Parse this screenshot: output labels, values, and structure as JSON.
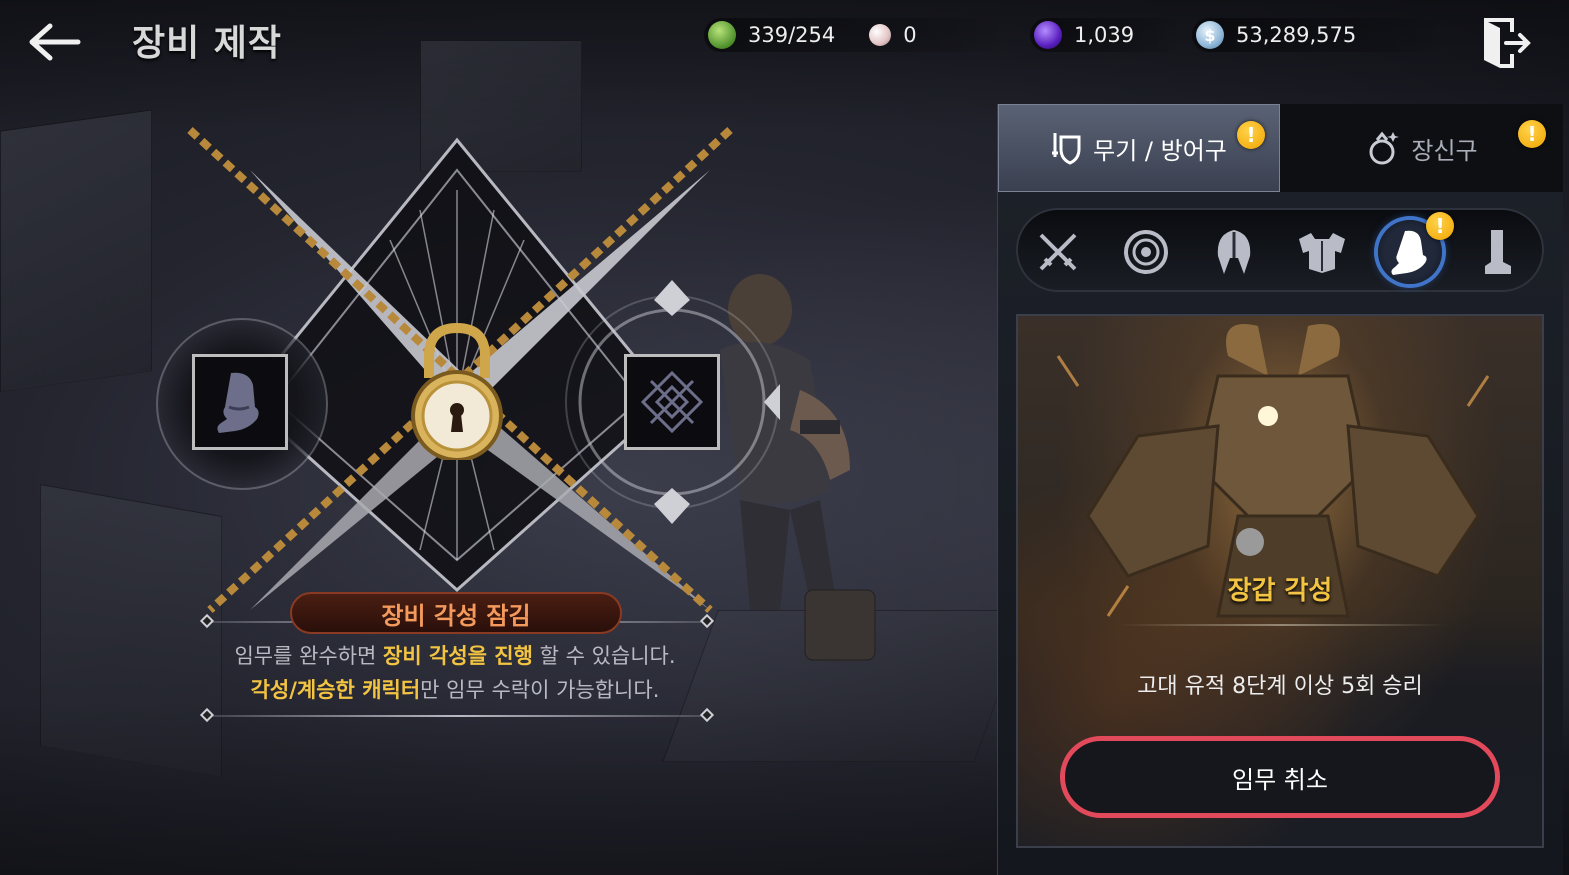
{
  "header": {
    "title": "장비 제작",
    "currencies": [
      {
        "icon": "green-gem-icon",
        "value": "339/254",
        "color": "#5fae3c"
      },
      {
        "icon": "pearl-icon",
        "value": "0",
        "color": "#e8c9c9"
      },
      {
        "icon": "purple-orb-icon",
        "value": "1,039",
        "color": "#6a2fc9"
      },
      {
        "icon": "silver-coin-icon",
        "value": "53,289,575",
        "color": "#8fb7d8"
      }
    ]
  },
  "awakening": {
    "locked_title": "장비 각성 잠김",
    "desc_line1_a": "임무를 완수하면 ",
    "desc_line1_hl": "장비 각성을 진행",
    "desc_line1_b": " 할 수 있습니다.",
    "desc_line2_hl": "각성/계승한 캐릭터",
    "desc_line2_b": "만 임무 수락이 가능합니다.",
    "left_slot_icon": "gauntlet-icon",
    "right_slot_icon": "awaken-symbol-icon"
  },
  "panel": {
    "tabs": [
      {
        "label": "무기 / 방어구",
        "icon": "weapon-armor-icon",
        "active": true,
        "alert": "!"
      },
      {
        "label": "장신구",
        "icon": "accessory-icon",
        "active": false,
        "alert": "!"
      }
    ],
    "categories": [
      {
        "name": "weapon",
        "icon": "crossed-swords-icon"
      },
      {
        "name": "shield",
        "icon": "shield-icon"
      },
      {
        "name": "helmet",
        "icon": "helmet-icon"
      },
      {
        "name": "armor",
        "icon": "chest-armor-icon"
      },
      {
        "name": "gloves",
        "icon": "gauntlet-icon",
        "selected": true,
        "alert": "!"
      },
      {
        "name": "boots",
        "icon": "boot-icon"
      }
    ],
    "card": {
      "title": "장갑 각성",
      "condition": "고대 유적 8단계 이상 5회 승리",
      "cancel_label": "임무 취소"
    }
  },
  "colors": {
    "highlight": "#f3c442",
    "locked_title": "#f39a5c",
    "cancel_border": "#e24a5c",
    "selected_ring": "#3f74c9",
    "alert": "#f0a400"
  }
}
